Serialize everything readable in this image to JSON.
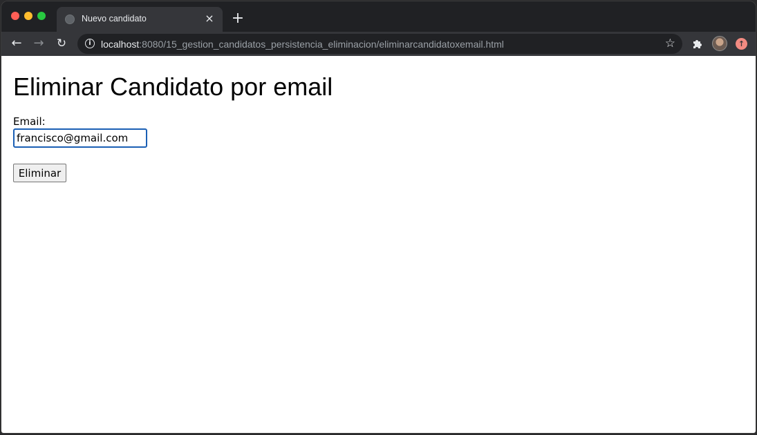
{
  "browser": {
    "tab": {
      "title": "Nuevo candidato"
    },
    "address_bar": {
      "host": "localhost",
      "path": ":8080/15_gestion_candidatos_persistencia_eliminacion/eliminarcandidatoxemail.html"
    },
    "icons": {
      "back": "arrow-back-icon",
      "forward": "arrow-forward-icon",
      "reload": "reload-icon",
      "site_info": "info-icon",
      "bookmark": "star-icon",
      "extensions": "puzzle-icon",
      "profile": "avatar",
      "update": "update-icon"
    }
  },
  "page": {
    "heading": "Eliminar Candidato por email",
    "form": {
      "email_label": "Email:",
      "email_value": "francisco@gmail.com",
      "submit_label": "Eliminar"
    }
  },
  "colors": {
    "input_focus_border": "#1a5fb4",
    "chrome_dark": "#35363a",
    "titlebar": "#202124"
  }
}
